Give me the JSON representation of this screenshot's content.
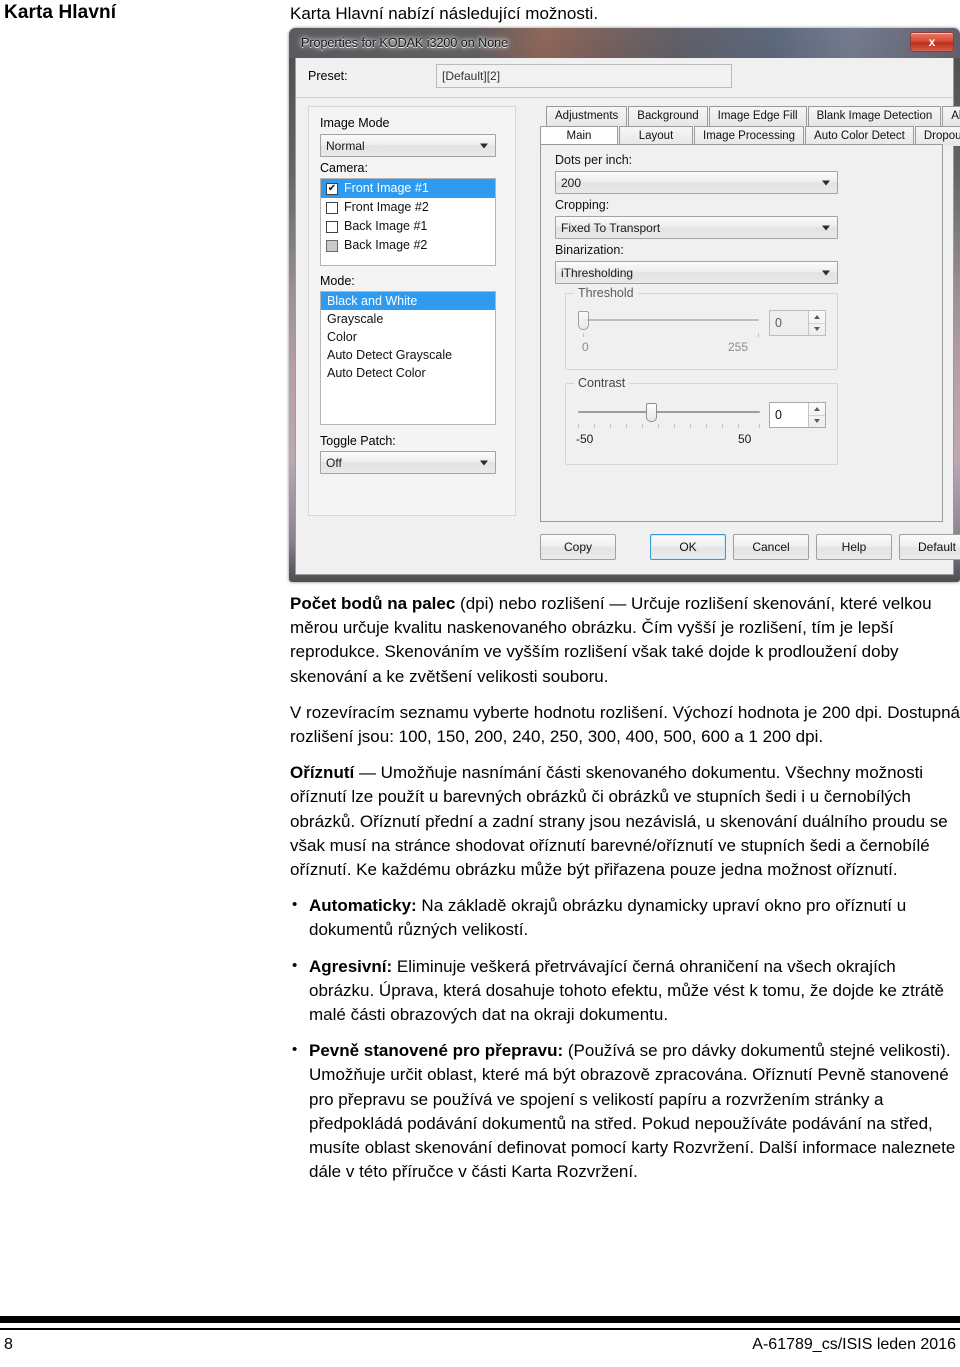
{
  "margin_heading": "Karta Hlavní",
  "intro": "Karta Hlavní nabízí následující možnosti.",
  "dialog": {
    "title": "Properties for KODAK i3200 on None",
    "close_label": "x",
    "preset_label": "Preset:",
    "preset_value": "[Default][2]",
    "image_mode_label": "Image Mode",
    "image_mode_value": "Normal",
    "camera_label": "Camera:",
    "camera_items": [
      {
        "label": "Front Image #1",
        "checked": true,
        "selected": true,
        "disabled": false
      },
      {
        "label": "Front Image #2",
        "checked": false,
        "selected": false,
        "disabled": false
      },
      {
        "label": "Back Image #1",
        "checked": false,
        "selected": false,
        "disabled": false
      },
      {
        "label": "Back Image #2",
        "checked": false,
        "selected": false,
        "disabled": true
      }
    ],
    "mode_label": "Mode:",
    "mode_items": [
      "Black and White",
      "Grayscale",
      "Color",
      "Auto Detect Grayscale",
      "Auto Detect Color"
    ],
    "mode_selected": "Black and White",
    "toggle_patch_label": "Toggle Patch:",
    "toggle_patch_value": "Off",
    "tabs_row1": [
      "Adjustments",
      "Background",
      "Image Edge Fill",
      "Blank Image Detection",
      "About"
    ],
    "tabs_row2": [
      "Main",
      "Layout",
      "Image Processing",
      "Auto Color Detect",
      "Dropout"
    ],
    "active_tab": "Main",
    "dpi_label": "Dots per inch:",
    "dpi_value": "200",
    "cropping_label": "Cropping:",
    "cropping_value": "Fixed To Transport",
    "binarization_label": "Binarization:",
    "binarization_value": "iThresholding",
    "threshold_title": "Threshold",
    "threshold_value": "0",
    "threshold_min": "0",
    "threshold_max": "255",
    "contrast_title": "Contrast",
    "contrast_value": "0",
    "contrast_min": "-50",
    "contrast_max": "50",
    "buttons": [
      "Copy",
      "OK",
      "Cancel",
      "Help",
      "Default"
    ],
    "accent_blue": "#2e9bf0",
    "default_button_outline": "#3c9ad6"
  },
  "body": {
    "p1_bold": "Počet bodů na palec",
    "p1_rest": " (dpi) nebo rozlišení — Určuje rozlišení skenování, které velkou měrou určuje kvalitu naskenovaného obrázku. Čím vyšší je rozlišení, tím je lepší reprodukce. Skenováním ve vyšším rozlišení však také dojde k prodloužení doby skenování a ke zvětšení velikosti souboru.",
    "p2": "V rozevíracím seznamu vyberte hodnotu rozlišení. Výchozí hodnota je 200 dpi. Dostupná rozlišení jsou: 100, 150, 200, 240, 250, 300, 400, 500, 600 a 1 200 dpi.",
    "p3_bold": "Oříznutí",
    "p3_rest": " — Umožňuje nasnímání části skenovaného dokumentu. Všechny možnosti oříznutí lze použít u barevných obrázků či obrázků ve stupních šedi i u černobílých obrázků. Oříznutí přední a zadní strany jsou nezávislá, u skenování duálního proudu se však musí na stránce shodovat oříznutí barevné/oříznutí ve stupních šedi a černobílé oříznutí. Ke každému obrázku může být přiřazena pouze jedna možnost oříznutí.",
    "bullets": [
      {
        "bold": "Automaticky:",
        "rest": " Na základě okrajů obrázku dynamicky upraví okno pro oříznutí u dokumentů různých velikostí."
      },
      {
        "bold": "Agresivní:",
        "rest": " Eliminuje veškerá přetrvávající černá ohraničení na všech okrajích obrázku. Úprava, která dosahuje tohoto efektu, může vést k tomu, že dojde ke ztrátě malé části obrazových dat na okraji dokumentu."
      },
      {
        "bold": "Pevně stanovené pro přepravu:",
        "rest": " (Používá se pro dávky dokumentů stejné velikosti). Umožňuje určit oblast, které má být obrazově zpracována. Oříznutí Pevně stanovené pro přepravu se používá ve spojení s velikostí papíru a rozvržením stránky a předpokládá podávání dokumentů na střed. Pokud nepoužíváte podávání na střed, musíte oblast skenování definovat pomocí karty Rozvržení. Další informace naleznete dále v této příručce v části Karta Rozvržení."
      }
    ]
  },
  "footer": {
    "page_number": "8",
    "doc_id": "A-61789_cs/ISIS leden 2016"
  }
}
